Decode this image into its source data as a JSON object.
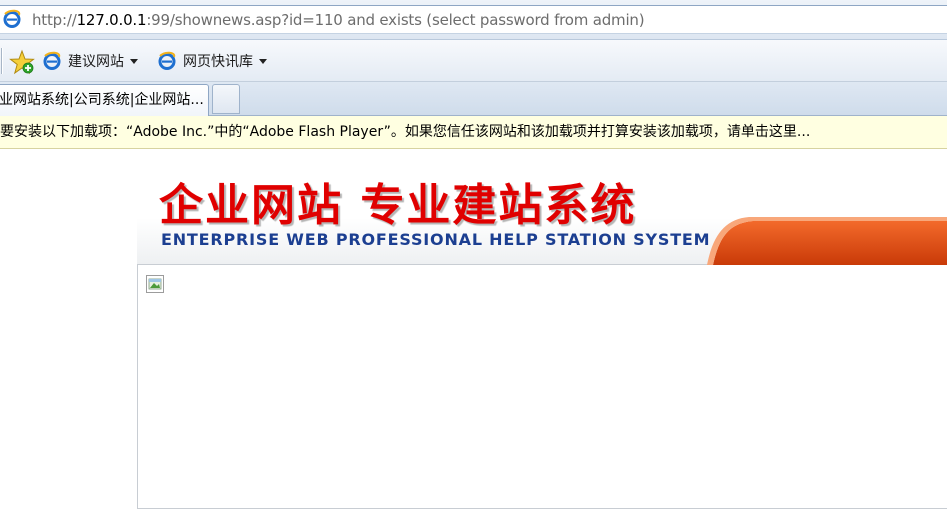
{
  "address_bar": {
    "url_scheme": "http://",
    "url_host": "127.0.0.1",
    "url_rest": ":99/shownews.asp?id=110 and exists (select password from admin)",
    "icon": "ie-icon"
  },
  "favorites_bar": {
    "star_icon": "favorites-star-icon",
    "links": [
      {
        "label": "建议网站",
        "icon": "ie-icon"
      },
      {
        "label": "网页快讯库",
        "icon": "ie-icon"
      }
    ]
  },
  "tabs": {
    "active_label": "业网站系统|公司系统|企业网站..."
  },
  "info_bar": {
    "message": "要安装以下加载项：“Adobe Inc.”中的“Adobe Flash Player”。如果您信任该网站和该加载项并打算安装该加载项，请单击这里..."
  },
  "page": {
    "banner_title_cn": "企业网站 专业建站系统",
    "banner_subtitle_en": "ENTERPRISE WEB PROFESSIONAL HELP STATION SYSTEM",
    "broken_image_icon": "broken-image-icon"
  },
  "colors": {
    "banner_red": "#e00000",
    "banner_blue": "#1c3f91",
    "swoosh_orange": "#e04a10",
    "infobar_bg": "#ffffe1"
  }
}
